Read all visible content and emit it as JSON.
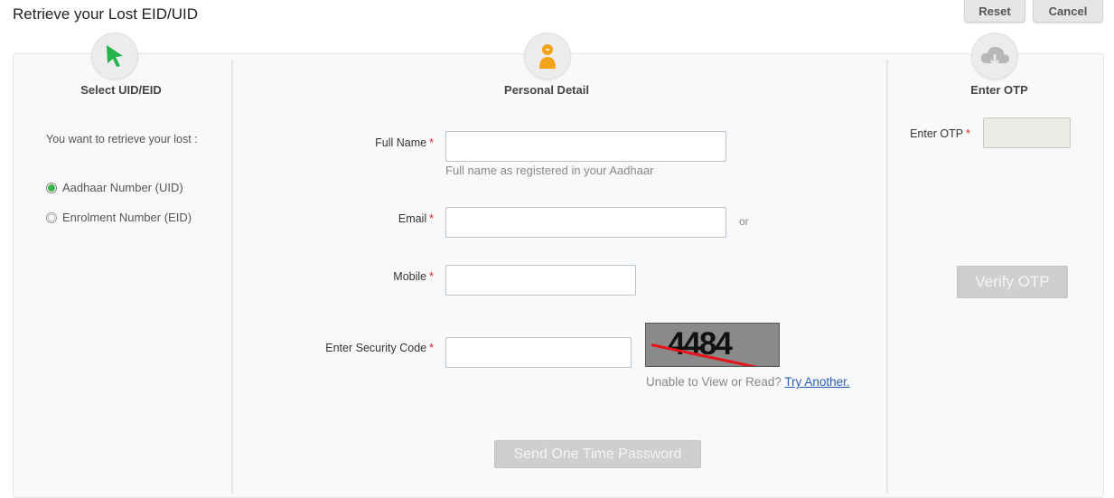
{
  "header": {
    "title": "Retrieve your Lost EID/UID",
    "reset_label": "Reset",
    "cancel_label": "Cancel"
  },
  "steps": [
    {
      "title": "Select UID/EID",
      "icon": "cursor-arrow-icon"
    },
    {
      "title": "Personal Detail",
      "icon": "person-icon"
    },
    {
      "title": "Enter OTP",
      "icon": "cloud-download-icon"
    }
  ],
  "select_panel": {
    "question": "You want to retrieve your lost :",
    "options": [
      {
        "label": "Aadhaar Number (UID)",
        "selected": true
      },
      {
        "label": "Enrolment Number (EID)",
        "selected": false
      }
    ]
  },
  "personal_panel": {
    "full_name": {
      "label": "Full Name",
      "value": "",
      "hint": "Full name as registered in your Aadhaar"
    },
    "email": {
      "label": "Email",
      "value": "",
      "or_text": "or"
    },
    "mobile": {
      "label": "Mobile",
      "value": ""
    },
    "security": {
      "label": "Enter Security Code",
      "value": "",
      "captcha_text": "4484",
      "unable_text": "Unable to View or Read?",
      "try_another": "Try Another."
    },
    "send_otp_label": "Send One Time Password"
  },
  "otp_panel": {
    "label": "Enter OTP",
    "value": "",
    "verify_label": "Verify OTP"
  },
  "required_marker": "*",
  "colors": {
    "radio_selected": "#3cb648",
    "required": "#d22222",
    "link": "#2a5db0",
    "captcha_line": "#e8141c"
  }
}
